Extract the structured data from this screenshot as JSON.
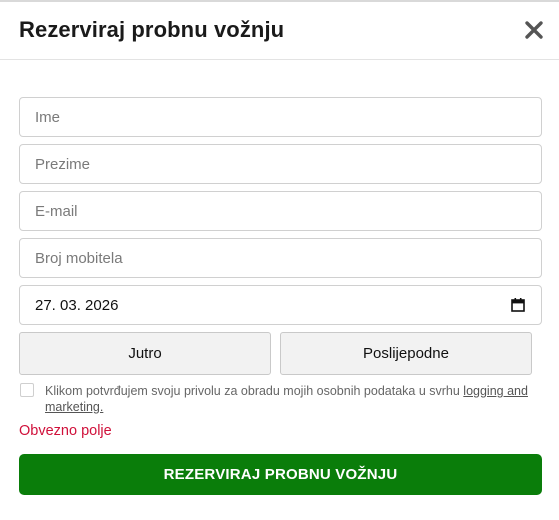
{
  "modal": {
    "title": "Rezerviraj probnu vožnju",
    "close_icon": "close-icon"
  },
  "form": {
    "first_name": {
      "placeholder": "Ime",
      "value": ""
    },
    "last_name": {
      "placeholder": "Prezime",
      "value": ""
    },
    "email": {
      "placeholder": "E-mail",
      "value": ""
    },
    "phone": {
      "placeholder": "Broj mobitela",
      "value": ""
    },
    "date": {
      "value": "27. 03. 2026",
      "icon": "calendar-icon"
    },
    "time_options": [
      "Jutro",
      "Poslijepodne"
    ],
    "consent": {
      "checked": false,
      "text": "Klikom potvrđujem svoju privolu za obradu mojih osobnih podataka u svrhu",
      "link": "logging and marketing."
    },
    "required_message": "Obvezno polje",
    "submit_label": "REZERVIRAJ PROBNU VOŽNJU"
  },
  "colors": {
    "accent": "#0a7d0a",
    "error": "#d0103a",
    "border": "#d0d0d0"
  }
}
